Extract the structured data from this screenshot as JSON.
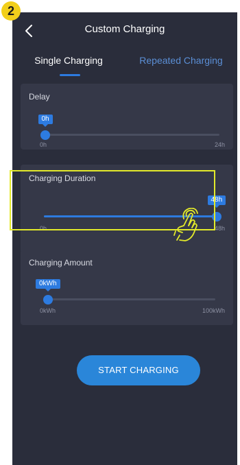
{
  "step": {
    "number": "2"
  },
  "header": {
    "title": "Custom Charging"
  },
  "tabs": [
    {
      "label": "Single Charging",
      "active": true
    },
    {
      "label": "Repeated Charging",
      "active": false
    }
  ],
  "delay": {
    "label": "Delay",
    "value_label": "0h",
    "min_label": "0h",
    "max_label": "24h",
    "fraction": 0
  },
  "duration": {
    "label": "Charging Duration",
    "value_label": "48h",
    "min_label": "0h",
    "max_label": "48h",
    "fraction": 1
  },
  "amount": {
    "label": "Charging Amount",
    "value_label": "0kWh",
    "min_label": "0kWh",
    "max_label": "100kWh",
    "fraction": 0
  },
  "actions": {
    "start_label": "START CHARGING"
  },
  "colors": {
    "accent": "#2d7be0",
    "background": "#2a2d3b",
    "card": "#353848",
    "highlight": "#e3ea2a",
    "badge": "#f2cf1b"
  },
  "icons": {
    "back": "chevron-left-icon",
    "gesture": "hand-pointer-icon"
  }
}
